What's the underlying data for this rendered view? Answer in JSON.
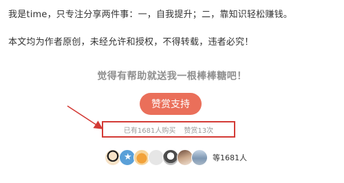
{
  "article": {
    "para1": "我是time，只专注分享两件事：一，自我提升；二，靠知识轻松赚钱。",
    "para2": "本文均为作者原创，未经允许和授权，不得转载，违者必究！"
  },
  "support": {
    "title": "觉得有帮助就送我一根棒棒糖吧！",
    "button_label": "赞赏支持",
    "purchased": "已有1681人购买",
    "rewards": "赞赏13次",
    "supporters_text": "等1681人",
    "accent_color": "#ea6f5a",
    "highlight_color": "#d33a35"
  },
  "avatars": [
    {
      "name": "avatar-1"
    },
    {
      "name": "avatar-2"
    },
    {
      "name": "avatar-3"
    },
    {
      "name": "avatar-4"
    },
    {
      "name": "avatar-5"
    },
    {
      "name": "avatar-6"
    },
    {
      "name": "avatar-7"
    }
  ]
}
